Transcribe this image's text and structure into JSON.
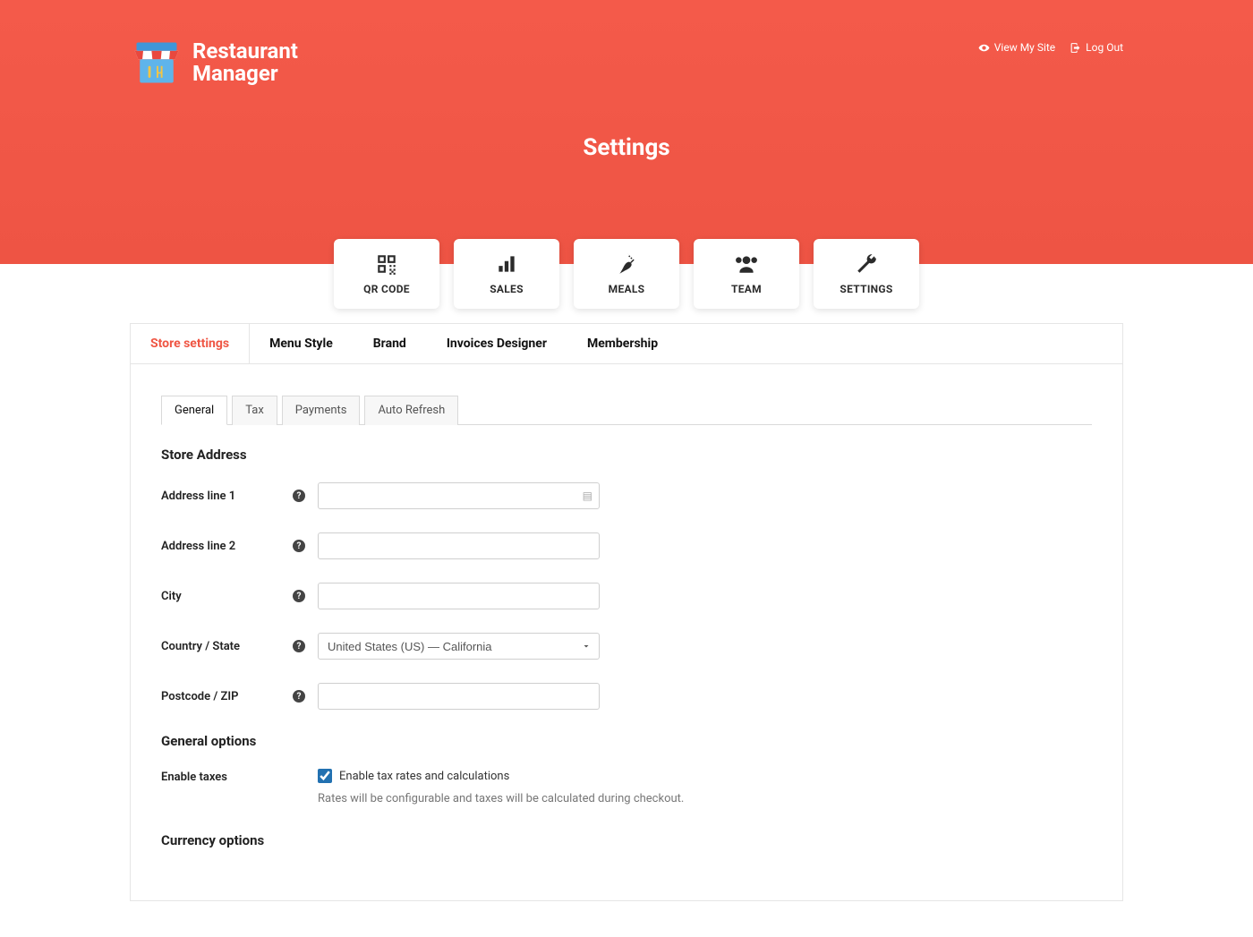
{
  "header": {
    "brand_line1": "Restaurant",
    "brand_line2": "Manager",
    "view_site": "View My Site",
    "logout": "Log Out",
    "page_title": "Settings"
  },
  "nav": [
    {
      "label": "QR CODE"
    },
    {
      "label": "SALES"
    },
    {
      "label": "MEALS"
    },
    {
      "label": "TEAM"
    },
    {
      "label": "SETTINGS",
      "active": true
    }
  ],
  "tabs": [
    {
      "label": "Store settings",
      "active": true
    },
    {
      "label": "Menu Style"
    },
    {
      "label": "Brand"
    },
    {
      "label": "Invoices Designer"
    },
    {
      "label": "Membership"
    }
  ],
  "subtabs": [
    {
      "label": "General",
      "active": true
    },
    {
      "label": "Tax"
    },
    {
      "label": "Payments"
    },
    {
      "label": "Auto Refresh"
    }
  ],
  "sections": {
    "store_address_title": "Store Address",
    "general_options_title": "General options",
    "currency_options_title": "Currency options"
  },
  "fields": {
    "address1": {
      "label": "Address line 1",
      "value": ""
    },
    "address2": {
      "label": "Address line 2",
      "value": ""
    },
    "city": {
      "label": "City",
      "value": ""
    },
    "country": {
      "label": "Country / State",
      "value": "United States (US) — California"
    },
    "postcode": {
      "label": "Postcode / ZIP",
      "value": ""
    }
  },
  "options": {
    "enable_taxes_label": "Enable taxes",
    "enable_taxes_check_label": "Enable tax rates and calculations",
    "enable_taxes_checked": true,
    "enable_taxes_desc": "Rates will be configurable and taxes will be calculated during checkout."
  }
}
